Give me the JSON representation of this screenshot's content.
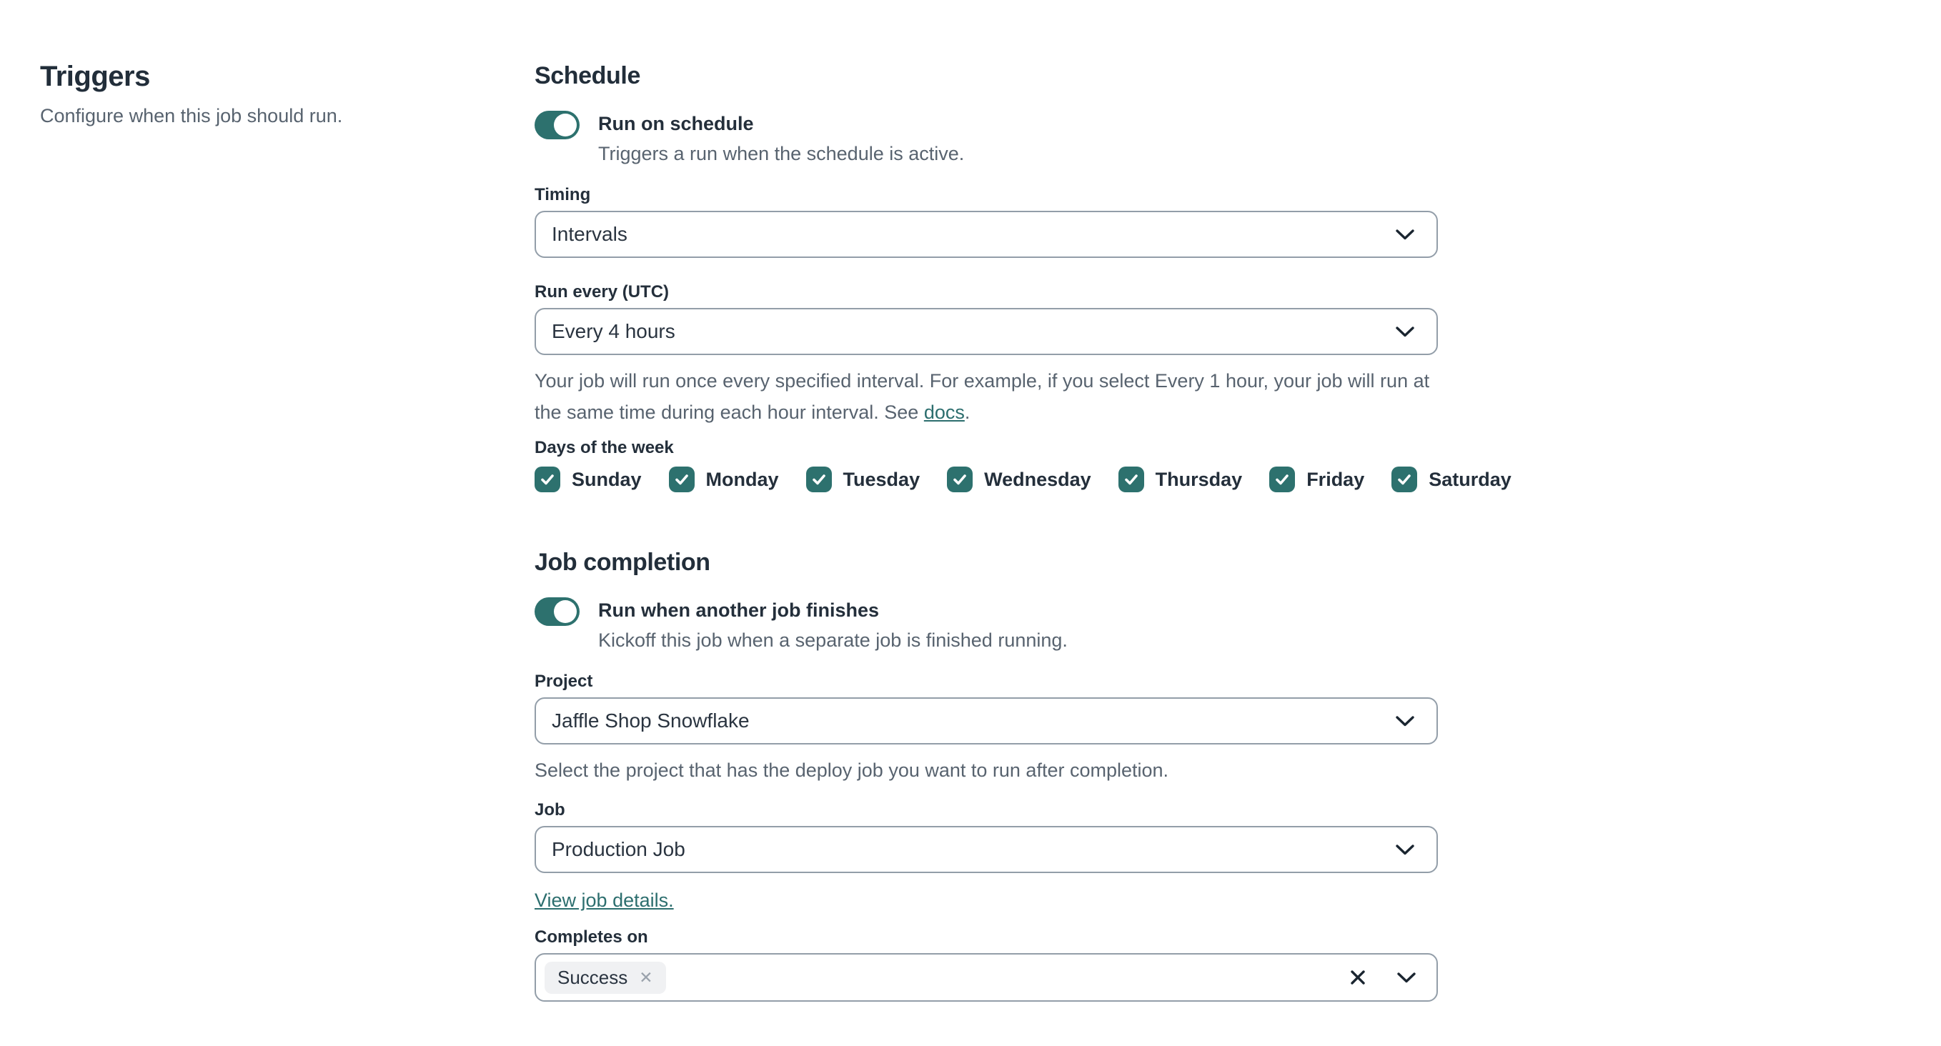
{
  "page": {
    "title": "Triggers",
    "subtitle": "Configure when this job should run."
  },
  "schedule": {
    "heading": "Schedule",
    "toggle": {
      "label": "Run on schedule",
      "description": "Triggers a run when the schedule is active.",
      "state": "on"
    },
    "timing": {
      "label": "Timing",
      "value": "Intervals"
    },
    "run_every": {
      "label": "Run every (UTC)",
      "value": "Every 4 hours"
    },
    "help": {
      "text_before": "Your job will run once every specified interval. For example, if you select Every 1 hour, your job will run at the same time during each hour interval. See ",
      "link_label": "docs",
      "text_after": "."
    },
    "days": {
      "label": "Days of the week",
      "items": [
        {
          "label": "Sunday",
          "checked": true
        },
        {
          "label": "Monday",
          "checked": true
        },
        {
          "label": "Tuesday",
          "checked": true
        },
        {
          "label": "Wednesday",
          "checked": true
        },
        {
          "label": "Thursday",
          "checked": true
        },
        {
          "label": "Friday",
          "checked": true
        },
        {
          "label": "Saturday",
          "checked": true
        }
      ]
    }
  },
  "job_completion": {
    "heading": "Job completion",
    "toggle": {
      "label": "Run when another job finishes",
      "description": "Kickoff this job when a separate job is finished running.",
      "state": "on"
    },
    "project": {
      "label": "Project",
      "value": "Jaffle Shop Snowflake",
      "help": "Select the project that has the deploy job you want to run after completion."
    },
    "job": {
      "label": "Job",
      "value": "Production Job",
      "link_label": "View job details."
    },
    "completes_on": {
      "label": "Completes on",
      "selected_tags": [
        {
          "label": "Success"
        }
      ]
    }
  },
  "colors": {
    "accent_teal": "#2d716e",
    "link_teal": "#2c6e6e",
    "text_dark": "#222e3a",
    "text_gray": "#58636f",
    "input_border": "#939ea9",
    "chip_background": "#f0f1f3"
  }
}
